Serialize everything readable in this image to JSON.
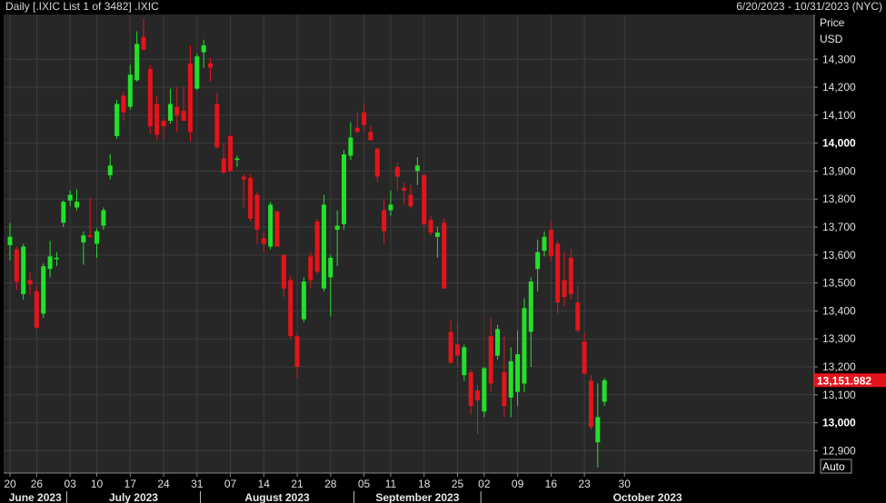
{
  "header": {
    "title": "Daily [.IXIC List 1 of 3482] .IXIC",
    "range": "6/20/2023 - 10/31/2023 (NYC)"
  },
  "axis": {
    "price_label": "Price",
    "currency_label": "USD",
    "auto_label": "Auto"
  },
  "colors": {
    "background": "#000000",
    "plot_bg": "#272727",
    "grid": "#3c3c3c",
    "up": "#22e02a",
    "down": "#e4141b",
    "last_price_bg": "#e4141b"
  },
  "chart_data": {
    "type": "candlestick",
    "symbol": ".IXIC",
    "ylim": [
      12820,
      14460
    ],
    "yticks": [
      12900,
      13000,
      13100,
      13200,
      13300,
      13400,
      13500,
      13600,
      13700,
      13800,
      13900,
      14000,
      14100,
      14200,
      14300
    ],
    "ytick_labels": [
      "12,900",
      "13,000",
      "13,100",
      "13,200",
      "13,300",
      "13,400",
      "13,500",
      "13,600",
      "13,700",
      "13,800",
      "13,900",
      "14,000",
      "14,100",
      "14,200",
      "14,300"
    ],
    "bold_ytick_labels": [
      "13,000",
      "14,000"
    ],
    "xtick_labels": [
      "20",
      "26",
      "03",
      "10",
      "17",
      "24",
      "31",
      "07",
      "14",
      "21",
      "28",
      "05",
      "11",
      "18",
      "25",
      "02",
      "09",
      "16",
      "23",
      "30"
    ],
    "xtick_dates": [
      "2023-06-20",
      "2023-06-26",
      "2023-07-03",
      "2023-07-10",
      "2023-07-17",
      "2023-07-24",
      "2023-07-31",
      "2023-08-07",
      "2023-08-14",
      "2023-08-21",
      "2023-08-28",
      "2023-09-05",
      "2023-09-11",
      "2023-09-18",
      "2023-09-25",
      "2023-10-02",
      "2023-10-09",
      "2023-10-16",
      "2023-10-23",
      "2023-10-30"
    ],
    "months": [
      {
        "label": "June 2023",
        "start": "2023-06-20"
      },
      {
        "label": "July 2023",
        "start": "2023-07-03"
      },
      {
        "label": "August 2023",
        "start": "2023-08-01"
      },
      {
        "label": "September 2023",
        "start": "2023-09-01"
      },
      {
        "label": "October 2023",
        "start": "2023-10-02"
      }
    ],
    "last_price": 13151.982,
    "last_price_label": "13,151.982",
    "candles": [
      {
        "date": "2023-06-20",
        "open": 13635,
        "high": 13715,
        "low": 13580,
        "close": 13665
      },
      {
        "date": "2023-06-21",
        "open": 13620,
        "high": 13630,
        "low": 13475,
        "close": 13505
      },
      {
        "date": "2023-06-22",
        "open": 13460,
        "high": 13640,
        "low": 13440,
        "close": 13630
      },
      {
        "date": "2023-06-23",
        "open": 13510,
        "high": 13540,
        "low": 13455,
        "close": 13495
      },
      {
        "date": "2023-06-26",
        "open": 13470,
        "high": 13490,
        "low": 13335,
        "close": 13340
      },
      {
        "date": "2023-06-27",
        "open": 13390,
        "high": 13570,
        "low": 13375,
        "close": 13560
      },
      {
        "date": "2023-06-28",
        "open": 13550,
        "high": 13650,
        "low": 13520,
        "close": 13595
      },
      {
        "date": "2023-06-29",
        "open": 13590,
        "high": 13610,
        "low": 13560,
        "close": 13590
      },
      {
        "date": "2023-06-30",
        "open": 13715,
        "high": 13795,
        "low": 13700,
        "close": 13790
      },
      {
        "date": "2023-07-03",
        "open": 13795,
        "high": 13830,
        "low": 13775,
        "close": 13815
      },
      {
        "date": "2023-07-05",
        "open": 13770,
        "high": 13835,
        "low": 13760,
        "close": 13790
      },
      {
        "date": "2023-07-06",
        "open": 13645,
        "high": 13685,
        "low": 13565,
        "close": 13670
      },
      {
        "date": "2023-07-07",
        "open": 13670,
        "high": 13805,
        "low": 13660,
        "close": 13665
      },
      {
        "date": "2023-07-10",
        "open": 13640,
        "high": 13695,
        "low": 13590,
        "close": 13685
      },
      {
        "date": "2023-07-11",
        "open": 13705,
        "high": 13770,
        "low": 13690,
        "close": 13760
      },
      {
        "date": "2023-07-12",
        "open": 13885,
        "high": 13960,
        "low": 13870,
        "close": 13920
      },
      {
        "date": "2023-07-13",
        "open": 14025,
        "high": 14155,
        "low": 14015,
        "close": 14140
      },
      {
        "date": "2023-07-14",
        "open": 14170,
        "high": 14185,
        "low": 14080,
        "close": 14110
      },
      {
        "date": "2023-07-17",
        "open": 14130,
        "high": 14280,
        "low": 14120,
        "close": 14245
      },
      {
        "date": "2023-07-18",
        "open": 14225,
        "high": 14400,
        "low": 14220,
        "close": 14355
      },
      {
        "date": "2023-07-19",
        "open": 14380,
        "high": 14445,
        "low": 14330,
        "close": 14335
      },
      {
        "date": "2023-07-20",
        "open": 14265,
        "high": 14280,
        "low": 14035,
        "close": 14060
      },
      {
        "date": "2023-07-21",
        "open": 14140,
        "high": 14170,
        "low": 14010,
        "close": 14030
      },
      {
        "date": "2023-07-24",
        "open": 14080,
        "high": 14090,
        "low": 14010,
        "close": 14060
      },
      {
        "date": "2023-07-25",
        "open": 14080,
        "high": 14195,
        "low": 14070,
        "close": 14140
      },
      {
        "date": "2023-07-26",
        "open": 14130,
        "high": 14200,
        "low": 14040,
        "close": 14100
      },
      {
        "date": "2023-07-27",
        "open": 14115,
        "high": 14200,
        "low": 14085,
        "close": 14080
      },
      {
        "date": "2023-07-28",
        "open": 14285,
        "high": 14350,
        "low": 14005,
        "close": 14040
      },
      {
        "date": "2023-07-31",
        "open": 14195,
        "high": 14320,
        "low": 14190,
        "close": 14310
      },
      {
        "date": "2023-08-01",
        "open": 14325,
        "high": 14370,
        "low": 14270,
        "close": 14350
      },
      {
        "date": "2023-08-02",
        "open": 14285,
        "high": 14305,
        "low": 14220,
        "close": 14270
      },
      {
        "date": "2023-08-03",
        "open": 14140,
        "high": 14180,
        "low": 13980,
        "close": 13985
      },
      {
        "date": "2023-08-04",
        "open": 13945,
        "high": 14000,
        "low": 13890,
        "close": 13895
      },
      {
        "date": "2023-08-07",
        "open": 14025,
        "high": 14030,
        "low": 13895,
        "close": 13900
      },
      {
        "date": "2023-08-08",
        "open": 13940,
        "high": 13955,
        "low": 13915,
        "close": 13945
      },
      {
        "date": "2023-08-09",
        "open": 13880,
        "high": 13890,
        "low": 13770,
        "close": 13870
      },
      {
        "date": "2023-08-10",
        "open": 13875,
        "high": 13890,
        "low": 13720,
        "close": 13730
      },
      {
        "date": "2023-08-11",
        "open": 13815,
        "high": 13825,
        "low": 13640,
        "close": 13690
      },
      {
        "date": "2023-08-14",
        "open": 13660,
        "high": 13680,
        "low": 13610,
        "close": 13640
      },
      {
        "date": "2023-08-15",
        "open": 13630,
        "high": 13790,
        "low": 13620,
        "close": 13780
      },
      {
        "date": "2023-08-16",
        "open": 13755,
        "high": 13760,
        "low": 13630,
        "close": 13630
      },
      {
        "date": "2023-08-17",
        "open": 13600,
        "high": 13605,
        "low": 13450,
        "close": 13480
      },
      {
        "date": "2023-08-18",
        "open": 13510,
        "high": 13525,
        "low": 13300,
        "close": 13310
      },
      {
        "date": "2023-08-21",
        "open": 13310,
        "high": 13320,
        "low": 13160,
        "close": 13200
      },
      {
        "date": "2023-08-22",
        "open": 13370,
        "high": 13520,
        "low": 13360,
        "close": 13505
      },
      {
        "date": "2023-08-23",
        "open": 13595,
        "high": 13610,
        "low": 13480,
        "close": 13510
      },
      {
        "date": "2023-08-24",
        "open": 13720,
        "high": 13730,
        "low": 13530,
        "close": 13540
      },
      {
        "date": "2023-08-25",
        "open": 13480,
        "high": 13815,
        "low": 13470,
        "close": 13780
      },
      {
        "date": "2023-08-28",
        "open": 13520,
        "high": 13600,
        "low": 13380,
        "close": 13590
      },
      {
        "date": "2023-08-29",
        "open": 13690,
        "high": 13760,
        "low": 13560,
        "close": 13705
      },
      {
        "date": "2023-08-30",
        "open": 13710,
        "high": 13975,
        "low": 13690,
        "close": 13960
      },
      {
        "date": "2023-08-31",
        "open": 13955,
        "high": 14075,
        "low": 13940,
        "close": 14020
      },
      {
        "date": "2023-09-01",
        "open": 14055,
        "high": 14110,
        "low": 14035,
        "close": 14040
      },
      {
        "date": "2023-09-05",
        "open": 14110,
        "high": 14140,
        "low": 14040,
        "close": 14065
      },
      {
        "date": "2023-09-06",
        "open": 14040,
        "high": 14060,
        "low": 14010,
        "close": 14010
      },
      {
        "date": "2023-09-07",
        "open": 13980,
        "high": 13985,
        "low": 13860,
        "close": 13880
      },
      {
        "date": "2023-09-08",
        "open": 13760,
        "high": 13800,
        "low": 13640,
        "close": 13685
      },
      {
        "date": "2023-09-11",
        "open": 13760,
        "high": 13830,
        "low": 13740,
        "close": 13780
      },
      {
        "date": "2023-09-12",
        "open": 13915,
        "high": 13930,
        "low": 13830,
        "close": 13880
      },
      {
        "date": "2023-09-13",
        "open": 13840,
        "high": 13860,
        "low": 13780,
        "close": 13830
      },
      {
        "date": "2023-09-14",
        "open": 13815,
        "high": 13850,
        "low": 13765,
        "close": 13775
      },
      {
        "date": "2023-09-15",
        "open": 13900,
        "high": 13950,
        "low": 13850,
        "close": 13920
      },
      {
        "date": "2023-09-18",
        "open": 13885,
        "high": 13890,
        "low": 13700,
        "close": 13710
      },
      {
        "date": "2023-09-19",
        "open": 13725,
        "high": 13740,
        "low": 13670,
        "close": 13680
      },
      {
        "date": "2023-09-20",
        "open": 13665,
        "high": 13700,
        "low": 13590,
        "close": 13680
      },
      {
        "date": "2023-09-21",
        "open": 13715,
        "high": 13730,
        "low": 13480,
        "close": 13480
      },
      {
        "date": "2023-09-22",
        "open": 13325,
        "high": 13370,
        "low": 13210,
        "close": 13215
      },
      {
        "date": "2023-09-25",
        "open": 13280,
        "high": 13360,
        "low": 13200,
        "close": 13240
      },
      {
        "date": "2023-09-26",
        "open": 13170,
        "high": 13280,
        "low": 13150,
        "close": 13270
      },
      {
        "date": "2023-09-27",
        "open": 13180,
        "high": 13190,
        "low": 13030,
        "close": 13060
      },
      {
        "date": "2023-09-28",
        "open": 13115,
        "high": 13135,
        "low": 12960,
        "close": 13080
      },
      {
        "date": "2023-10-02",
        "open": 13040,
        "high": 13200,
        "low": 13020,
        "close": 13195
      },
      {
        "date": "2023-10-03",
        "open": 13310,
        "high": 13375,
        "low": 13110,
        "close": 13140
      },
      {
        "date": "2023-10-04",
        "open": 13240,
        "high": 13350,
        "low": 13225,
        "close": 13335
      },
      {
        "date": "2023-10-05",
        "open": 13180,
        "high": 13310,
        "low": 13020,
        "close": 13060
      },
      {
        "date": "2023-10-06",
        "open": 13090,
        "high": 13270,
        "low": 13020,
        "close": 13220
      },
      {
        "date": "2023-10-09",
        "open": 13110,
        "high": 13330,
        "low": 13060,
        "close": 13245
      },
      {
        "date": "2023-10-10",
        "open": 13140,
        "high": 13445,
        "low": 13110,
        "close": 13410
      },
      {
        "date": "2023-10-11",
        "open": 13325,
        "high": 13520,
        "low": 13200,
        "close": 13505
      },
      {
        "date": "2023-10-12",
        "open": 13550,
        "high": 13655,
        "low": 13470,
        "close": 13610
      },
      {
        "date": "2023-10-13",
        "open": 13615,
        "high": 13685,
        "low": 13595,
        "close": 13665
      },
      {
        "date": "2023-10-16",
        "open": 13690,
        "high": 13720,
        "low": 13575,
        "close": 13595
      },
      {
        "date": "2023-10-17",
        "open": 13640,
        "high": 13650,
        "low": 13390,
        "close": 13430
      },
      {
        "date": "2023-10-18",
        "open": 13510,
        "high": 13610,
        "low": 13415,
        "close": 13450
      },
      {
        "date": "2023-10-19",
        "open": 13590,
        "high": 13620,
        "low": 13440,
        "close": 13460
      },
      {
        "date": "2023-10-20",
        "open": 13430,
        "high": 13490,
        "low": 13320,
        "close": 13330
      },
      {
        "date": "2023-10-23",
        "open": 13290,
        "high": 13320,
        "low": 13175,
        "close": 13175
      },
      {
        "date": "2023-10-24",
        "open": 13150,
        "high": 13170,
        "low": 12975,
        "close": 12985
      },
      {
        "date": "2023-10-25",
        "open": 12930,
        "high": 13140,
        "low": 12840,
        "close": 13020
      },
      {
        "date": "2023-10-26",
        "open": 13075,
        "high": 13160,
        "low": 13060,
        "close": 13152
      }
    ]
  }
}
